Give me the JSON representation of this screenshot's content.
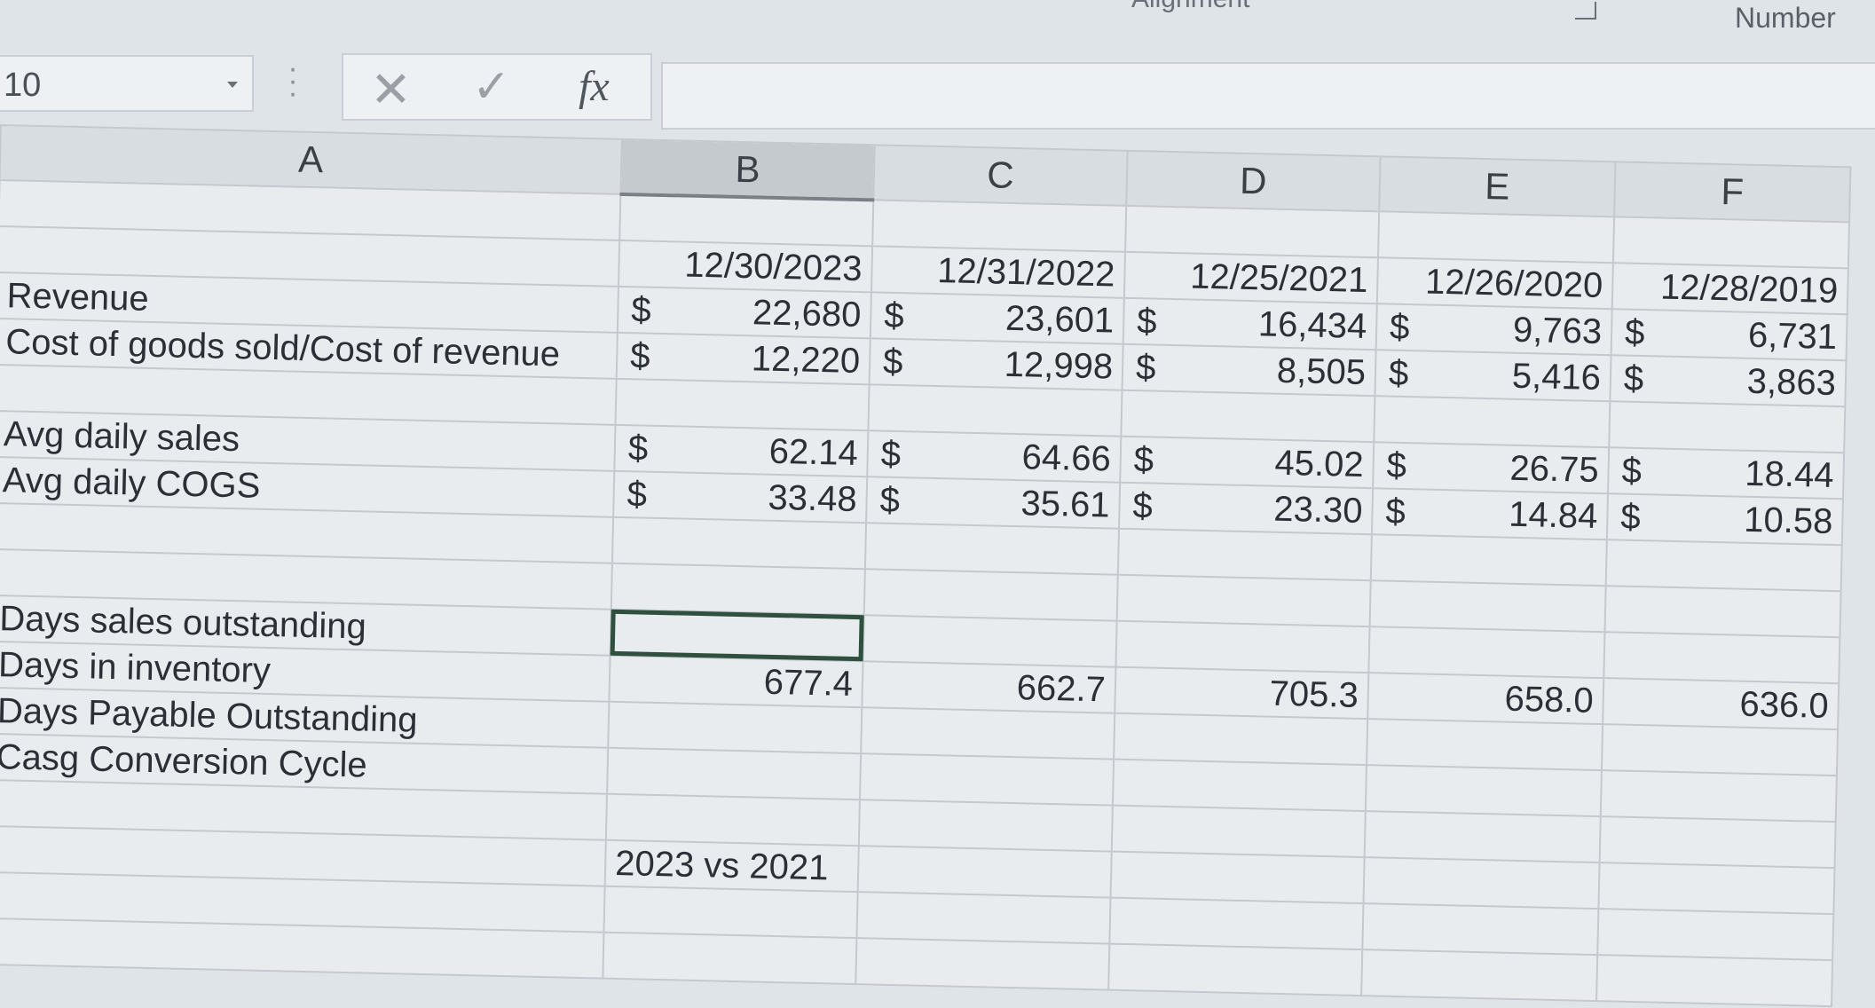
{
  "ribbon": {
    "alignment_label": "Alignment",
    "number_label": "Number"
  },
  "formula_bar": {
    "name_box": "10",
    "cancel_symbol": "✕",
    "enter_symbol": "✓",
    "fx_symbol": "fx",
    "formula_value": ""
  },
  "columns": [
    "A",
    "B",
    "C",
    "D",
    "E",
    "F"
  ],
  "dates": [
    "12/30/2023",
    "12/31/2022",
    "12/25/2021",
    "12/26/2020",
    "12/28/2019"
  ],
  "currency_symbol": "$",
  "rows": {
    "revenue": {
      "label": "Revenue",
      "values": [
        "22,680",
        "23,601",
        "16,434",
        "9,763",
        "6,731"
      ]
    },
    "cogs": {
      "label": "Cost of goods sold/Cost of revenue",
      "values": [
        "12,220",
        "12,998",
        "8,505",
        "5,416",
        "3,863"
      ]
    },
    "avg_daily_sales": {
      "label": "Avg daily sales",
      "values": [
        "62.14",
        "64.66",
        "45.02",
        "26.75",
        "18.44"
      ]
    },
    "avg_daily_cogs": {
      "label": "Avg daily COGS",
      "values": [
        "33.48",
        "35.61",
        "23.30",
        "14.84",
        "10.58"
      ]
    },
    "dso": {
      "label": "Days sales outstanding",
      "values": [
        "",
        "",
        "",
        "",
        ""
      ]
    },
    "dii": {
      "label": "Days in inventory",
      "values": [
        "677.4",
        "662.7",
        "705.3",
        "658.0",
        "636.0"
      ]
    },
    "dpo": {
      "label": "Days Payable Outstanding",
      "values": [
        "",
        "",
        "",
        "",
        ""
      ]
    },
    "ccc": {
      "label": "Casg Conversion Cycle",
      "values": [
        "",
        "",
        "",
        "",
        ""
      ]
    }
  },
  "comparison_label": "2023 vs 2021"
}
